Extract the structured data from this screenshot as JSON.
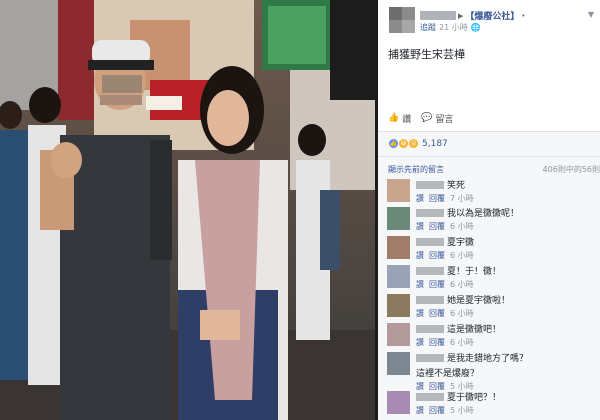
{
  "post": {
    "page_name": "【爆廢公社】",
    "action_label": "追蹤",
    "time": "21 小時",
    "text": "捕獲野生宋芸樺"
  },
  "actions": {
    "like": "讚",
    "comment": "留言"
  },
  "reactions": {
    "count": "5,187"
  },
  "comments_header": {
    "previous": "顯示先前的留言",
    "count": "406則中的56則"
  },
  "comment_actions": {
    "like": "讚",
    "reply": "回覆"
  },
  "comments": [
    {
      "text": "笑死",
      "time": "7 小時",
      "avatar_color": "#c9a58f"
    },
    {
      "text": "我以為是黴黴呢！",
      "time": "6 小時",
      "avatar_color": "#6b8a7a"
    },
    {
      "text": "夏宇黴",
      "time": "6 小時",
      "avatar_color": "#a27c6a"
    },
    {
      "text": "夏！于！黴！",
      "time": "6 小時",
      "avatar_color": "#9aa3b5"
    },
    {
      "text": "她是夏宇黴啦！",
      "time": "6 小時",
      "avatar_color": "#8c7a60"
    },
    {
      "text": "這是黴黴吧！",
      "time": "6 小時",
      "avatar_color": "#b29a9a"
    },
    {
      "text": "是我走錯地方了嗎？",
      "line2": "這裡不是爆廢？",
      "time": "5 小時",
      "avatar_color": "#7d8791"
    },
    {
      "text": "夏于黴吧？！",
      "time": "5 小時",
      "avatar_color": "#a88bb3"
    }
  ],
  "colors": {
    "link": "#385898",
    "muted": "#90949c",
    "comments_bg": "#f6f7f9"
  }
}
